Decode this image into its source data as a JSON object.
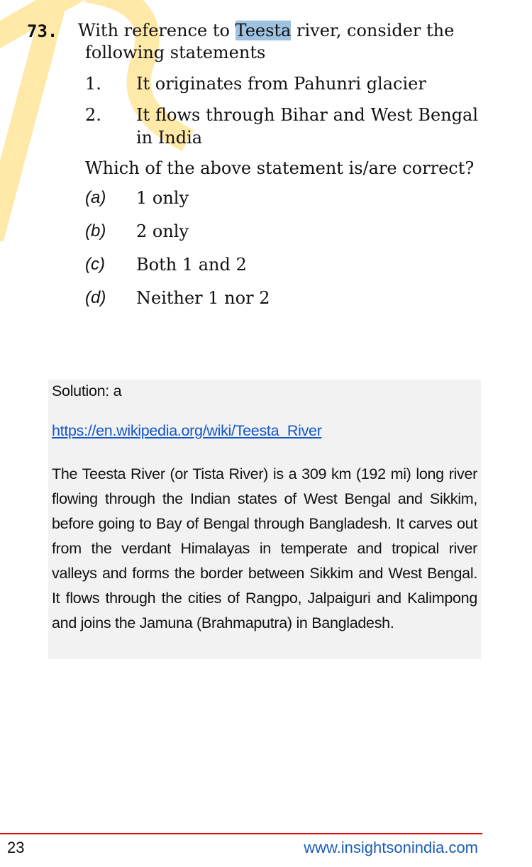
{
  "question": {
    "number": "73.",
    "stem_before": "With reference to ",
    "stem_highlight": "Teesta",
    "stem_after": " river, consider the",
    "stem_line2": "following statements",
    "statements": [
      {
        "num": "1.",
        "text": "It originates from Pahunri glacier"
      },
      {
        "num": "2.",
        "text": "It flows through Bihar and West Bengal in India"
      }
    ],
    "ask": "Which of the above statement is/are correct?",
    "options": [
      {
        "label": "(a)",
        "text": "1 only"
      },
      {
        "label": "(b)",
        "text": "2 only"
      },
      {
        "label": "(c)",
        "text": "Both 1 and 2"
      },
      {
        "label": "(d)",
        "text": "Neither 1 nor 2"
      }
    ]
  },
  "solution": {
    "answer": "Solution: a",
    "link": "https://en.wikipedia.org/wiki/Teesta_River",
    "text": "The Teesta River (or Tista River) is a 309 km (192 mi) long river flowing through the Indian states of West Bengal and Sikkim, before going to Bay of Bengal through Bangladesh. It carves out from the verdant Himalayas in temperate and tropical river valleys and forms the border between Sikkim and West Bengal. It flows through the cities of Rangpo, Jalpaiguri and Kalimpong and joins the Jamuna (Brahmaputra) in Bangladesh."
  },
  "footer": {
    "page_number": "23",
    "website": "www.insightsonindia.com"
  },
  "colors": {
    "watermark": "#ffe9a8",
    "highlight": "#9ec2e0",
    "solution_bg": "#f2f2f2",
    "link": "#1155cc",
    "footer_rule": "#e30000",
    "footer_site": "#1a5db4"
  }
}
